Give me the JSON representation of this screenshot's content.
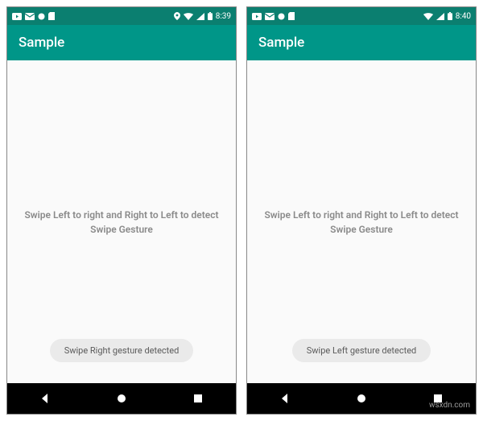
{
  "screens": [
    {
      "status": {
        "time": "8:39",
        "icons_left": [
          "youtube",
          "gmail",
          "sim"
        ],
        "icons_right": [
          "location",
          "wifi",
          "signal",
          "battery"
        ]
      },
      "app_title": "Sample",
      "instruction": "Swipe Left to right and Right to Left to detect Swipe Gesture",
      "toast": "Swipe Right gesture detected"
    },
    {
      "status": {
        "time": "8:40",
        "icons_left": [
          "youtube",
          "gmail",
          "sim"
        ],
        "icons_right": [
          "wifi",
          "signal",
          "battery"
        ]
      },
      "app_title": "Sample",
      "instruction": "Swipe Left to right and Right to Left to detect Swipe Gesture",
      "toast": "Swipe Left gesture detected"
    }
  ],
  "watermark": "wsxdn.com"
}
